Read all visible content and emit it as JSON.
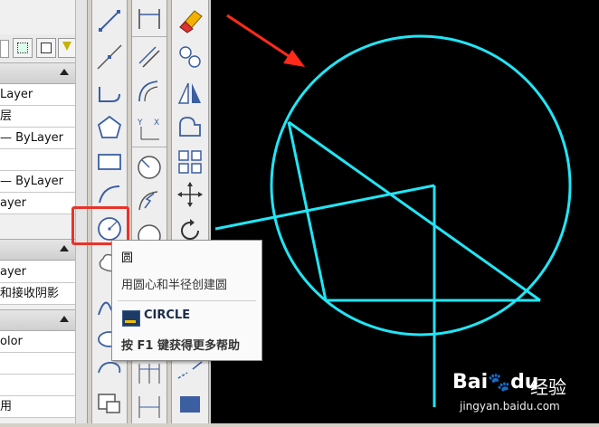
{
  "properties_palette": {
    "rows_a": [
      "Layer",
      "层",
      "— ByLayer",
      "",
      "— ByLayer",
      "ayer"
    ],
    "rows_b": [
      "ayer",
      "和接收阴影"
    ],
    "rows_c": [
      "olor",
      "",
      "",
      "用"
    ]
  },
  "tooltip": {
    "title": "圆",
    "description": "用圆心和半径创建圆",
    "command": "CIRCLE",
    "help": "按 F1 键获得更多帮助"
  },
  "watermark": {
    "brand": "Bai",
    "brand_suffix": "du",
    "site_cn": "经验",
    "url": "jingyan.baidu.com"
  },
  "colors": {
    "drawing_cyan": "#22e5f5",
    "highlight_red": "#e8332a",
    "arrow_red": "#ff2a1a"
  }
}
